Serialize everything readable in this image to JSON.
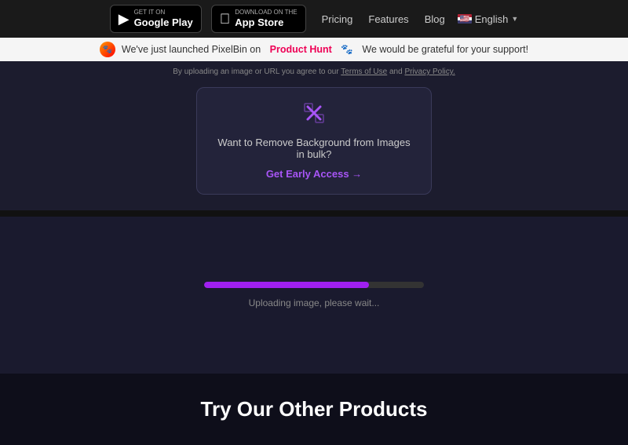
{
  "navbar": {
    "google_play_label_small": "GET IT ON",
    "google_play_label_big": "Google Play",
    "app_store_label_small": "Download on the",
    "app_store_label_big": "App Store",
    "links": [
      {
        "label": "Pricing",
        "id": "pricing"
      },
      {
        "label": "Features",
        "id": "features"
      },
      {
        "label": "Blog",
        "id": "blog"
      }
    ],
    "language": "English"
  },
  "announcement": {
    "text_before": "We've just launched  PixelBin on",
    "link_text": "Product Hunt",
    "text_after": "🐾  We would be grateful for your support!"
  },
  "terms": {
    "text": "By uploading an image or URL you agree to our",
    "terms_link": "Terms of Use",
    "and": " and ",
    "privacy_link": "Privacy Policy."
  },
  "bulk_card": {
    "icon": "✕✕",
    "text": "Want to Remove Background from Images in bulk?",
    "cta": "Get Early Access →"
  },
  "progress": {
    "label": "Uploading image, please wait...",
    "percent": 75
  },
  "other_products": {
    "title": "Try Our Other Products"
  }
}
